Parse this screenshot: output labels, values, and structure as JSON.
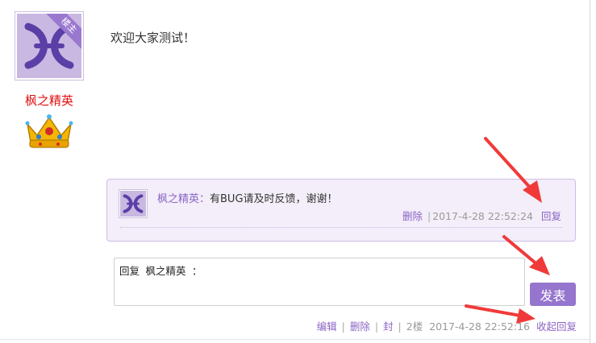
{
  "post": {
    "author_badge": "楼主",
    "author_name": "枫之精英",
    "content": "欢迎大家测试！"
  },
  "reply": {
    "author": "枫之精英：",
    "text": "有BUG请及时反馈，谢谢！",
    "delete_label": "删除",
    "separator": "|",
    "timestamp": "2017-4-28 22:52:24",
    "reply_label": "回复"
  },
  "editor": {
    "value": "回复 枫之精英 ：",
    "submit_label": "发表"
  },
  "footer": {
    "edit_label": "编辑",
    "delete_label": "删除",
    "ban_label": "封",
    "separator": "|",
    "floor": "2楼",
    "timestamp": "2017-4-28 22:52:16",
    "collapse_label": "收起回复"
  },
  "colors": {
    "accent": "#9575cd",
    "link": "#8a65c4",
    "author_name": "#e01010",
    "reply_bg": "#f3eef9",
    "annotation_arrow": "#f03a3a"
  },
  "icons": [
    "avatar-logo-icon",
    "crown-icon",
    "arrow-annotation-icon"
  ]
}
